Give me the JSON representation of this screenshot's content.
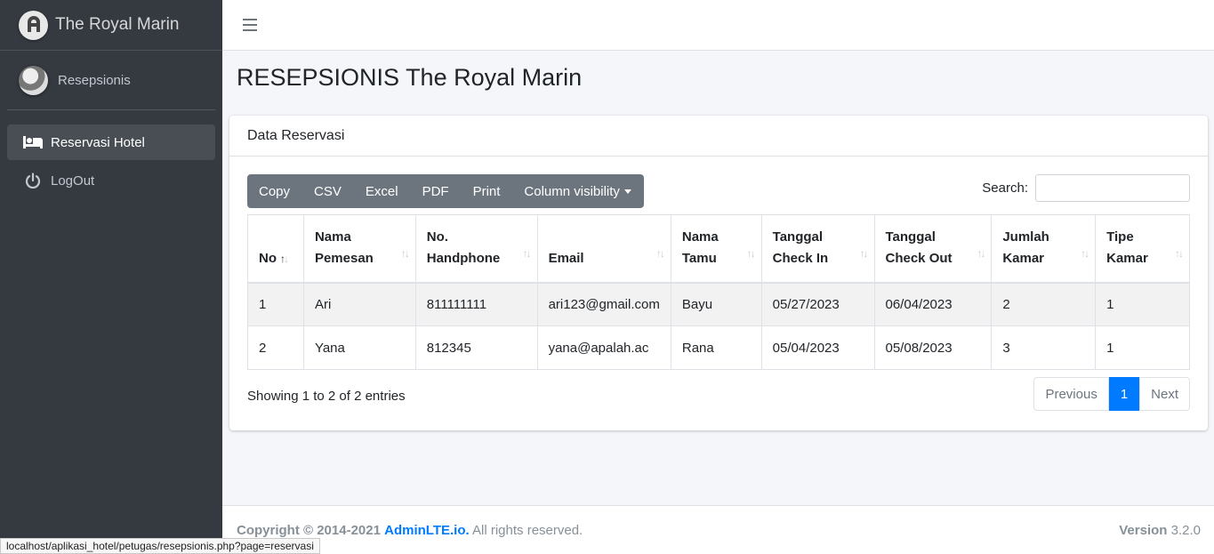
{
  "brand": {
    "name": "The Royal Marin"
  },
  "user": {
    "name": "Resepsionis"
  },
  "nav": [
    {
      "label": "Reservasi Hotel",
      "icon": "bed-icon",
      "active": true
    },
    {
      "label": "LogOut",
      "icon": "power-icon",
      "active": false
    }
  ],
  "page": {
    "title": "RESEPSIONIS The Royal Marin"
  },
  "card": {
    "title": "Data Reservasi"
  },
  "buttons": {
    "copy": "Copy",
    "csv": "CSV",
    "excel": "Excel",
    "pdf": "PDF",
    "print": "Print",
    "colvis": "Column visibility"
  },
  "search": {
    "label": "Search:",
    "value": ""
  },
  "table": {
    "headers": [
      [
        "No",
        ""
      ],
      [
        "Nama",
        "Pemesan"
      ],
      [
        "No.",
        "Handphone"
      ],
      [
        "Email",
        ""
      ],
      [
        "Nama",
        "Tamu"
      ],
      [
        "Tanggal",
        "Check In"
      ],
      [
        "Tanggal",
        "Check Out"
      ],
      [
        "Jumlah",
        "Kamar"
      ],
      [
        "Tipe",
        "Kamar"
      ]
    ],
    "rows": [
      [
        "1",
        "Ari",
        "811111111",
        "ari123@gmail.com",
        "Bayu",
        "05/27/2023",
        "06/04/2023",
        "2",
        "1"
      ],
      [
        "2",
        "Yana",
        "812345",
        "yana@apalah.ac",
        "Rana",
        "05/04/2023",
        "05/08/2023",
        "3",
        "1"
      ]
    ]
  },
  "info": "Showing 1 to 2 of 2 entries",
  "pagination": {
    "previous": "Previous",
    "current": "1",
    "next": "Next"
  },
  "footer": {
    "copyright": "Copyright © 2014-2021",
    "link": "AdminLTE.io.",
    "rights": "All rights reserved.",
    "version_label": "Version",
    "version": "3.2.0"
  },
  "status_url": "localhost/aplikasi_hotel/petugas/resepsionis.php?page=reservasi",
  "colors": {
    "sidebar": "#343a40",
    "primary": "#007bff",
    "button": "#6c757d"
  }
}
